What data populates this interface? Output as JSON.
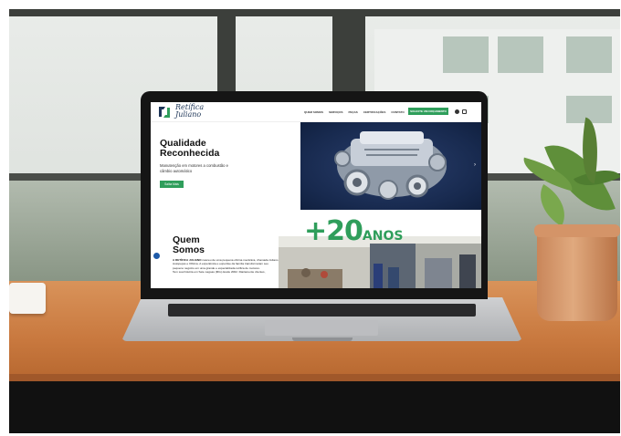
{
  "site": {
    "logo_line1": "Retífica",
    "logo_line2": "Juliano",
    "nav": [
      "QUEM SOMOS",
      "SERVIÇOS",
      "PEÇAS",
      "CERTIFICAÇÕES",
      "CONTATO"
    ],
    "cta": "SOLICITE UM ORÇAMENTO",
    "hero": {
      "title": "Qualidade Reconhecida",
      "subtitle": "Manutenção em motores a combustão e câmbio automático",
      "button": "Saiba Mais"
    },
    "about": {
      "title_line1": "Quem",
      "title_line2": "Somos",
      "brand": "A RETÍFICA JULIANO",
      "text1": " nasceu de uma pequena oficina mecânica, chamada Juliano Autopeças e Oficina. A experiência e expertise da família transformaram seu pequeno negócio em uma grande e especializada retífica de motores.",
      "text2": "Tem sua história em Sete Lagoas (MG) desde 2002. Diariamente clientes,"
    },
    "badge_plus": "+20",
    "badge_anos": "ANOS"
  },
  "colors": {
    "accent": "#2f9e5b",
    "navy": "#1d3557"
  },
  "icons": [
    "facebook-icon",
    "instagram-icon",
    "chevron-right-icon",
    "accessibility-icon"
  ]
}
